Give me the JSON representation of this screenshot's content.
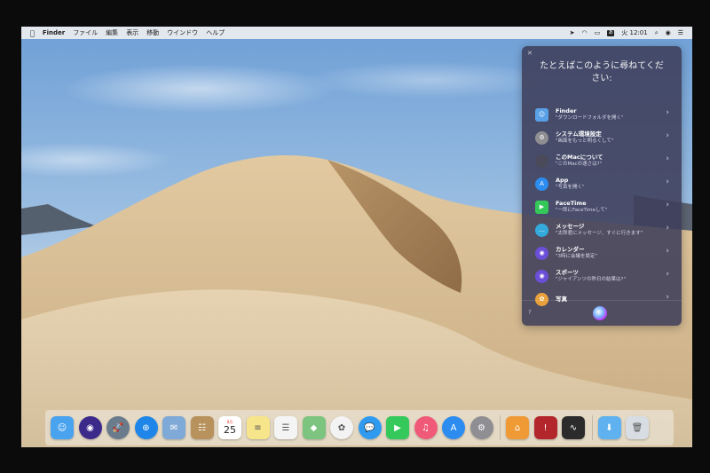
{
  "menubar": {
    "app_name": "Finder",
    "menus": [
      "ファイル",
      "編集",
      "表示",
      "移動",
      "ウインドウ",
      "ヘルプ"
    ],
    "input_method": "あ",
    "clock": "火 12:01"
  },
  "siri": {
    "prompt": "たとえばこのように尋ねてください:",
    "suggestions": [
      {
        "title": "Finder",
        "subtitle": "\"ダウンロードフォルダを開く\"",
        "icon": "finder-icon",
        "color": "#5aa0e6"
      },
      {
        "title": "システム環境設定",
        "subtitle": "\"画面をもっと明るくして\"",
        "icon": "gear-icon",
        "color": "#8e8e93"
      },
      {
        "title": "このMacについて",
        "subtitle": "\"このMacの速さは?\"",
        "icon": "apple-icon",
        "color": "#4a4a5a"
      },
      {
        "title": "App",
        "subtitle": "\"写真を開く\"",
        "icon": "app-store-icon",
        "color": "#2d8cf0"
      },
      {
        "title": "FaceTime",
        "subtitle": "\"一郎にFaceTimeして\"",
        "icon": "facetime-icon",
        "color": "#34c759"
      },
      {
        "title": "メッセージ",
        "subtitle": "\"太郎君にメッセージ、すぐに行きます\"",
        "icon": "messages-icon",
        "color": "#34aadc"
      },
      {
        "title": "カレンダー",
        "subtitle": "\"3時に会議を設定\"",
        "icon": "siri-calendar-icon",
        "color": "#6b4fd8"
      },
      {
        "title": "スポーツ",
        "subtitle": "\"ジャイアンツの昨日の結果は?\"",
        "icon": "siri-sports-icon",
        "color": "#6b4fd8"
      },
      {
        "title": "写真",
        "subtitle": "",
        "icon": "photos-icon",
        "color": "#e9a23b"
      }
    ],
    "help_label": "?"
  },
  "dock": {
    "calendar_month": "8月",
    "calendar_day": "25",
    "apps": [
      {
        "name": "finder",
        "color": "#4aa3ef",
        "round": false,
        "glyph": "☺"
      },
      {
        "name": "siri",
        "color": "#3b2a8a",
        "round": true,
        "glyph": "◉"
      },
      {
        "name": "launchpad",
        "color": "#6a7b8c",
        "round": true,
        "glyph": "🚀"
      },
      {
        "name": "safari",
        "color": "#1e86e8",
        "round": true,
        "glyph": "⊕"
      },
      {
        "name": "mail",
        "color": "#7fa9d6",
        "round": false,
        "glyph": "✉"
      },
      {
        "name": "contacts",
        "color": "#b8925c",
        "round": false,
        "glyph": "☷"
      },
      {
        "name": "calendar",
        "color": "#ffffff",
        "round": false,
        "glyph": ""
      },
      {
        "name": "notes",
        "color": "#f7e58c",
        "round": false,
        "glyph": "≡"
      },
      {
        "name": "reminders",
        "color": "#f4f4f4",
        "round": false,
        "glyph": "☰"
      },
      {
        "name": "maps",
        "color": "#7cc47f",
        "round": false,
        "glyph": "◆"
      },
      {
        "name": "photos",
        "color": "#f3f3f3",
        "round": true,
        "glyph": "✿"
      },
      {
        "name": "messages",
        "color": "#2f9bf0",
        "round": true,
        "glyph": "💬"
      },
      {
        "name": "facetime",
        "color": "#35c95b",
        "round": false,
        "glyph": "▶"
      },
      {
        "name": "itunes",
        "color": "#f05a78",
        "round": true,
        "glyph": "♫"
      },
      {
        "name": "app-store",
        "color": "#2d8cf0",
        "round": true,
        "glyph": "A"
      },
      {
        "name": "system-preferences",
        "color": "#8e8e93",
        "round": true,
        "glyph": "⚙"
      },
      {
        "name": "home",
        "color": "#f09a36",
        "round": false,
        "glyph": "⌂"
      },
      {
        "name": "photo-booth",
        "color": "#b3262b",
        "round": false,
        "glyph": "!"
      },
      {
        "name": "activity-monitor",
        "color": "#2b2b2b",
        "round": false,
        "glyph": "∿"
      },
      {
        "name": "downloads",
        "color": "#5fb2ef",
        "round": false,
        "glyph": "⬇"
      },
      {
        "name": "trash",
        "color": "#d7dde3",
        "round": false,
        "glyph": "🗑"
      }
    ]
  }
}
